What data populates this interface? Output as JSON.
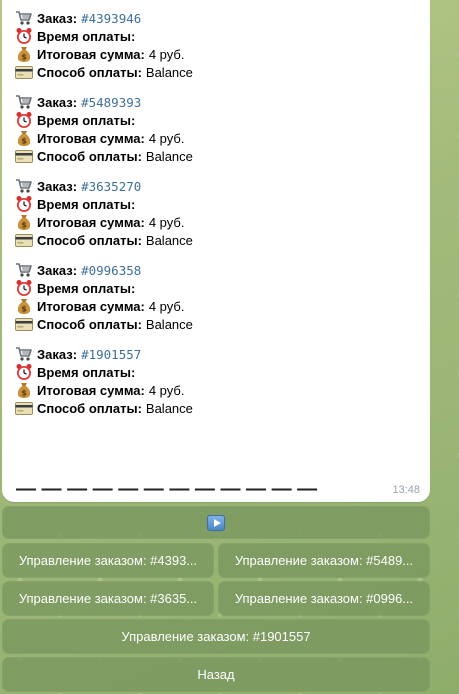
{
  "labels": {
    "order": "Заказ:",
    "paytime": "Время оплаты:",
    "total": "Итоговая сумма:",
    "method": "Способ оплаты:"
  },
  "orders": [
    {
      "code": "#4393946",
      "paytime": "",
      "total": "4 руб.",
      "method": "Balance"
    },
    {
      "code": "#5489393",
      "paytime": "",
      "total": "4 руб.",
      "method": "Balance"
    },
    {
      "code": "#3635270",
      "paytime": "",
      "total": "4 руб.",
      "method": "Balance"
    },
    {
      "code": "#0996358",
      "paytime": "",
      "total": "4 руб.",
      "method": "Balance"
    },
    {
      "code": "#1901557",
      "paytime": "",
      "total": "4 руб.",
      "method": "Balance"
    }
  ],
  "separator": "— — — — — — — — — — — —",
  "message_time": "13:48",
  "icons": {
    "order": "cart-icon",
    "paytime": "alarm-clock-icon",
    "total": "money-bag-icon",
    "method": "credit-card-icon",
    "next": "play-icon"
  },
  "keyboard": {
    "manage": [
      "Управление заказом: #4393...",
      "Управление заказом: #5489...",
      "Управление заказом: #3635...",
      "Управление заказом: #0996...",
      "Управление заказом: #1901557"
    ],
    "back": "Назад"
  },
  "colors": {
    "order_code": "#3f6f9a",
    "button_bg": "#78965f",
    "chat_bg": "#a3bb7a"
  }
}
